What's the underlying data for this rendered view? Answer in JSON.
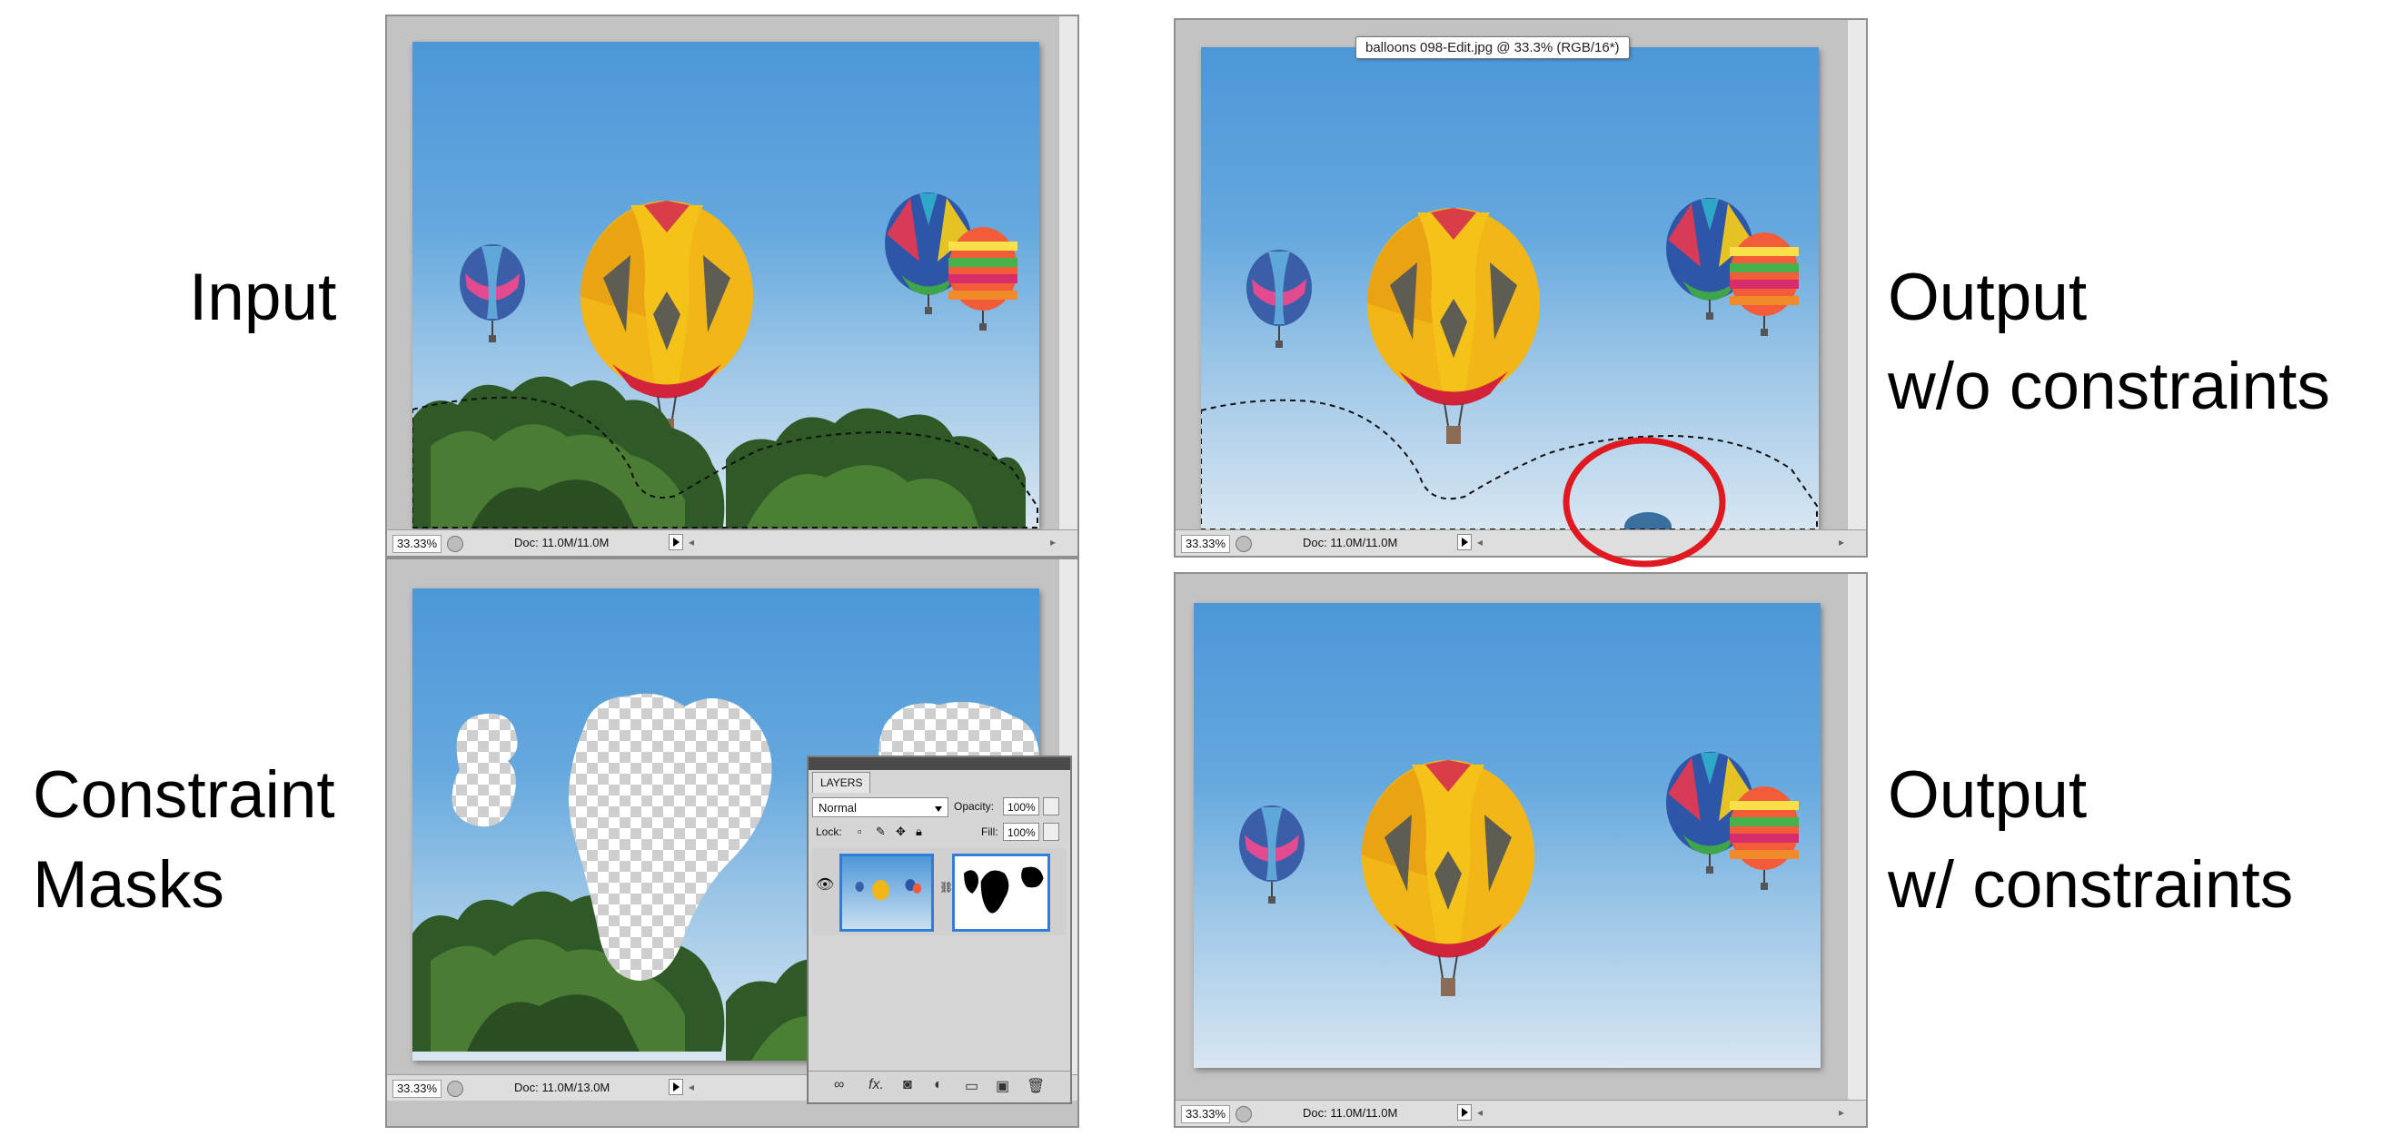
{
  "labels": {
    "input": "Input",
    "output_without_line1": "Output",
    "output_without_line2": "w/o constraints",
    "constraint_line1": "Constraint",
    "constraint_line2": "Masks",
    "output_with_line1": "Output",
    "output_with_line2": "w/ constraints"
  },
  "panels": {
    "input": {
      "zoom": "33.33%",
      "doc": "Doc: 11.0M/11.0M"
    },
    "output_without": {
      "zoom": "33.33%",
      "doc": "Doc: 11.0M/11.0M",
      "tooltip": "balloons 098-Edit.jpg @ 33.3% (RGB/16*)"
    },
    "constraint": {
      "zoom": "33.33%",
      "doc": "Doc: 11.0M/13.0M"
    },
    "output_with": {
      "zoom": "33.33%",
      "doc": "Doc: 11.0M/11.0M"
    }
  },
  "layers_panel": {
    "tab": "LAYERS",
    "blend_mode": "Normal",
    "opacity_label": "Opacity:",
    "opacity_value": "100%",
    "lock_label": "Lock:",
    "fill_label": "Fill:",
    "fill_value": "100%",
    "footer_fx": "fx."
  },
  "colors": {
    "highlight_circle": "#e0181f",
    "selection_border": "#2f7fd8",
    "panel_bg": "#c3c3c3",
    "sky_top": "#4d97d8",
    "sky_bottom": "#d8e6f1"
  }
}
